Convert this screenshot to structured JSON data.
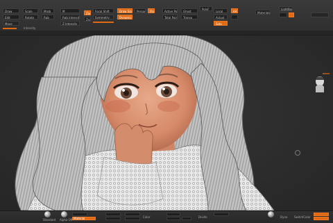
{
  "topbar": {
    "row1": [
      "Draw",
      "Edit",
      "Move",
      "Scale",
      "Rotate",
      "Mrgb",
      "Rgb",
      "M",
      "Zadd",
      "Zsub",
      "Focal Shift",
      "Draw Size",
      "Dynamic",
      "Active Points",
      "Total Points",
      "Materials",
      "LightBox"
    ],
    "row2": [
      "Rgb Intensity",
      "Z Intensity",
      "Symmetry",
      "Perspective",
      "Floor",
      "Solo"
    ],
    "row3": [
      "Ghost",
      "Transp",
      "PolyF",
      "Local",
      "Actual",
      "AAHalf"
    ],
    "active_tool_label": "Intensity"
  },
  "viewport": {
    "light_indicator": "light-position"
  },
  "bottombar": {
    "items": [
      "Standard",
      "Alpha Off",
      "Dot",
      "Texture Off",
      "Zoom",
      "Move",
      "BrushMod",
      "Stroke",
      "Material",
      "Color",
      "Gradient",
      "Switch",
      "Alternate",
      "SwitchColor",
      "Zprojection",
      "Divide",
      "Dyna"
    ],
    "active_item": "Material"
  },
  "colors": {
    "accent": "#e06a14",
    "background": "#2a2a2a",
    "panel": "#333333"
  }
}
